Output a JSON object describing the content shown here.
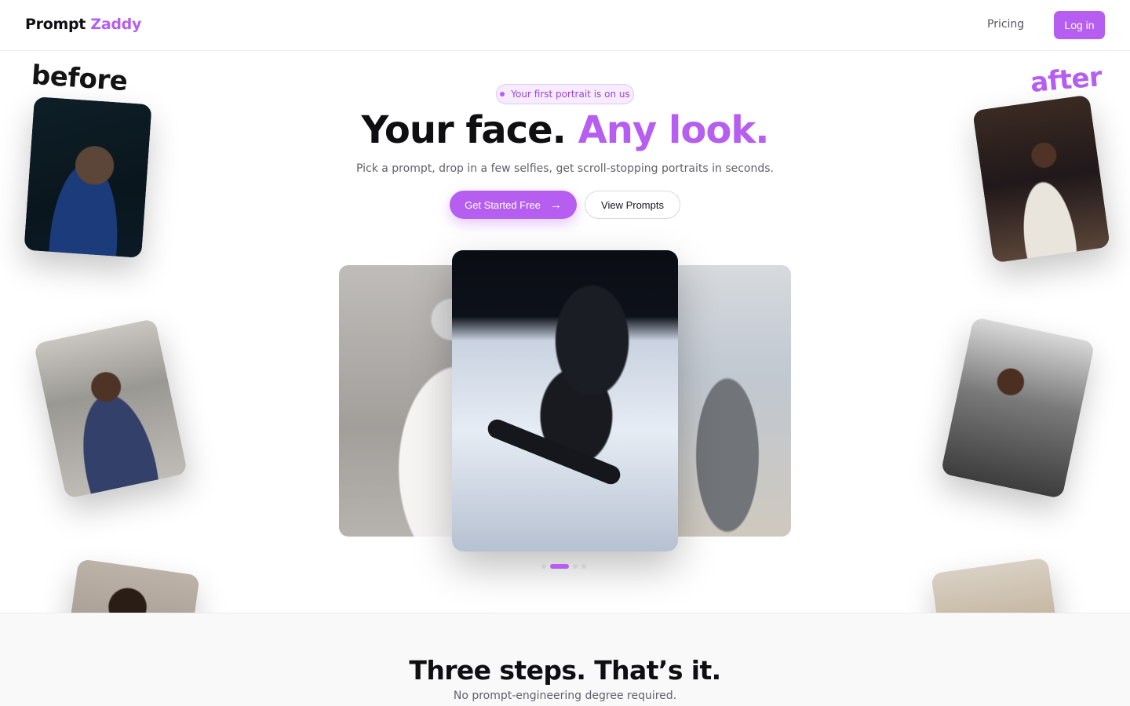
{
  "header": {
    "logo_word1": "Prompt",
    "logo_word2": "Zaddy",
    "nav_pricing": "Pricing",
    "login_label": "Log in"
  },
  "labels": {
    "before": "before",
    "after": "after"
  },
  "hero": {
    "badge": "Your first portrait is on us",
    "title_part1": "Your face.",
    "title_part2": "Any look.",
    "subtitle": "Pick a prompt, drop in a few selfies, get scroll-stopping portraits in seconds.",
    "cta_primary": "Get Started Free",
    "cta_secondary": "View Prompts"
  },
  "carousel": {
    "dots": 4,
    "active_index": 1
  },
  "steps": {
    "title": "Three steps. That’s it.",
    "subtitle": "No prompt-engineering degree required."
  },
  "colors": {
    "accent": "#b55ef0",
    "text": "#0f0f12",
    "muted": "#60606a"
  },
  "icons": {
    "primary_cta": "arrow-right-icon"
  }
}
